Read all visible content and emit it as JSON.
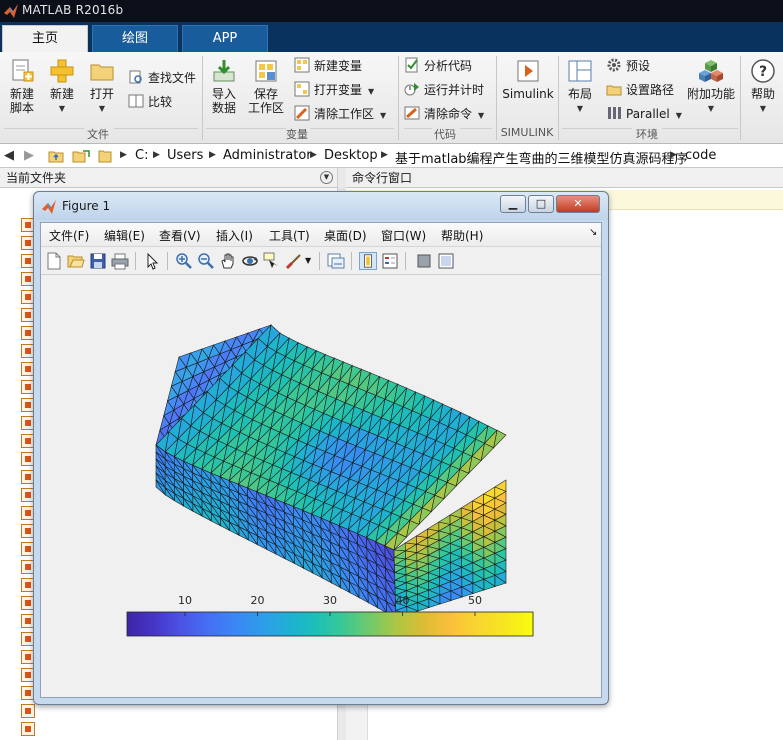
{
  "app": {
    "title": "MATLAB R2016b"
  },
  "ribbon_tabs": [
    {
      "label": "主页"
    },
    {
      "label": "绘图"
    },
    {
      "label": "APP"
    }
  ],
  "ribbon": {
    "file": {
      "group_label": "文件",
      "new_script_l1": "新建",
      "new_script_l2": "脚本",
      "new_label": "新建",
      "open_label": "打开",
      "find_files_label": "查找文件",
      "compare_label": "比较"
    },
    "variable": {
      "group_label": "变量",
      "import_l1": "导入",
      "import_l2": "数据",
      "save_ws_l1": "保存",
      "save_ws_l2": "工作区",
      "new_var_label": "新建变量",
      "open_var_label": "打开变量",
      "clear_ws_label": "清除工作区"
    },
    "code": {
      "group_label": "代码",
      "analyze_label": "分析代码",
      "run_time_label": "运行并计时",
      "clear_cmds_label": "清除命令"
    },
    "simulink": {
      "group_label": "SIMULINK",
      "simulink_label": "Simulink"
    },
    "environment": {
      "group_label": "环境",
      "layout_label": "布局",
      "preferences_label": "预设",
      "set_path_label": "设置路径",
      "parallel_label": "Parallel",
      "addons_label": "附加功能"
    },
    "resources": {
      "help_label": "帮助"
    }
  },
  "address_bar": {
    "path": [
      "C:",
      "Users",
      "Administrator",
      "Desktop",
      "基于matlab编程产生弯曲的三维模型仿真源码程序",
      "code"
    ]
  },
  "current_folder": {
    "title": "当前文件夹",
    "file_count": 29
  },
  "command_window": {
    "title": "命令行窗口",
    "notice_text": ""
  },
  "figure": {
    "title": "Figure 1",
    "menu": [
      "文件(F)",
      "编辑(E)",
      "查看(V)",
      "插入(I)",
      "工具(T)",
      "桌面(D)",
      "窗口(W)",
      "帮助(H)"
    ],
    "toolbar_icons": [
      "new-figure-icon",
      "open-file-icon",
      "save-icon",
      "print-icon",
      "pointer-icon",
      "zoom-in-icon",
      "zoom-out-icon",
      "pan-icon",
      "rotate-3d-icon",
      "data-cursor-icon",
      "brush-icon",
      "link-plot-icon",
      "colorbar-icon",
      "legend-icon",
      "hide-plot-tools-icon",
      "show-plot-tools-icon"
    ],
    "colorbar": {
      "ticks": [
        "10",
        "20",
        "30",
        "40",
        "50"
      ],
      "tick_values": [
        10,
        20,
        30,
        40,
        50
      ],
      "range": [
        2,
        58
      ]
    },
    "colormap": [
      "#3e26a8",
      "#4637c9",
      "#4b54e6",
      "#4570f5",
      "#3b87f6",
      "#2e9de9",
      "#1fb0d3",
      "#1cc0b6",
      "#3ac894",
      "#73c96a",
      "#aec643",
      "#dcbc35",
      "#fbc03b",
      "#f8d530",
      "#f6e620",
      "#f9fb0e"
    ]
  },
  "colors": {
    "titlebar": "#0b0f1a",
    "tabstrip": "#09335e",
    "active_tab": "#f2f2f2"
  }
}
